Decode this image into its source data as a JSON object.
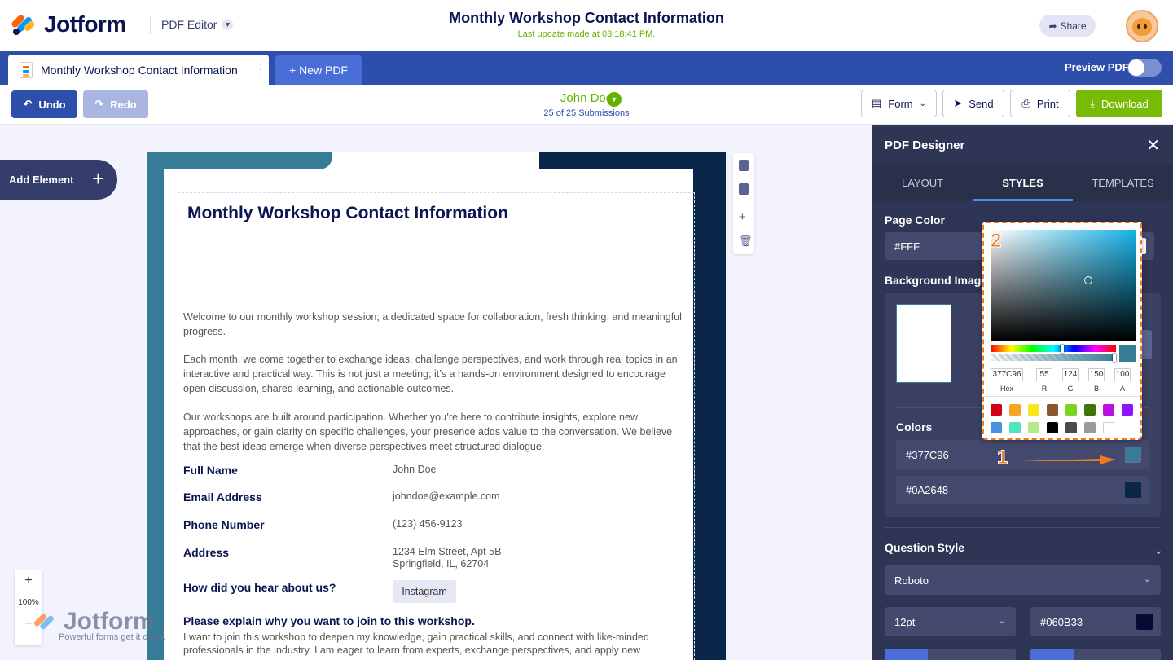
{
  "header": {
    "brand": "Jotform",
    "product": "PDF Editor",
    "doc_title": "Monthly Workshop Contact Information",
    "last_update": "Last update made at 03:18:41 PM.",
    "share_label": "Share"
  },
  "tabs": {
    "active_label": "Monthly Workshop Contact Information",
    "new_label": "+ New PDF",
    "preview_label": "Preview PDF",
    "preview_on": false
  },
  "actions": {
    "undo": "Undo",
    "redo": "Redo",
    "submitter": "John Doe",
    "submission_count": "25 of 25 Submissions",
    "form": "Form",
    "send": "Send",
    "print": "Print",
    "download": "Download"
  },
  "left": {
    "add_element": "Add Element",
    "zoom_in": "+",
    "zoom_level": "100%",
    "zoom_out": "−"
  },
  "watermark": {
    "brand": "Jotform",
    "tagline": "Powerful forms get it done."
  },
  "document": {
    "title": "Monthly Workshop Contact Information",
    "paragraphs": [
      "Welcome to our monthly workshop session; a dedicated space for collaboration, fresh thinking, and meaningful progress.",
      "Each month, we come together to exchange ideas, challenge perspectives, and work through real topics in an interactive and practical way. This is not just a meeting; it’s a hands-on environment designed to encourage open discussion, shared learning, and actionable outcomes.",
      "Our workshops are built around participation. Whether you’re here to contribute insights, explore new approaches, or gain clarity on specific challenges, your presence adds value to the conversation. We believe that the best ideas emerge when diverse perspectives meet structured dialogue."
    ],
    "fields": [
      {
        "label": "Full Name",
        "value": "John Doe"
      },
      {
        "label": "Email Address",
        "value": "johndoe@example.com"
      },
      {
        "label": "Phone Number",
        "value": "(123) 456-9123"
      },
      {
        "label": "Address",
        "value": "1234 Elm Street, Apt 5B",
        "value2": "Springfield, IL, 62704"
      },
      {
        "label": "How did you hear about us?",
        "value": "Instagram"
      }
    ],
    "essay_label": "Please explain why you want to join to this workshop.",
    "essay_text": "I want to join this workshop to deepen my knowledge, gain practical skills, and connect with like-minded professionals in the industry. I am eager to learn from experts, exchange perspectives, and apply new"
  },
  "panel": {
    "title": "PDF Designer",
    "tabs": [
      "LAYOUT",
      "STYLES",
      "TEMPLATES"
    ],
    "active_tab": "STYLES",
    "page_color_label": "Page Color",
    "page_color_value": "#FFF",
    "background_image_label": "Background Image",
    "colors_label": "Colors",
    "color1": "#377C96",
    "color2": "#0A2648",
    "question_style_label": "Question Style",
    "font": "Roboto",
    "font_size": "12pt",
    "font_color": "#060B33"
  },
  "picker": {
    "hex": "377C96",
    "r": "55",
    "g": "124",
    "b": "150",
    "a": "100",
    "labels": [
      "Hex",
      "R",
      "G",
      "B",
      "A"
    ],
    "presets": [
      "#d0021b",
      "#f5a623",
      "#f8e71c",
      "#8b572a",
      "#7ed321",
      "#417505",
      "#bd10e0",
      "#9013fe",
      "#4a90e2",
      "#50e3c2",
      "#b8e986",
      "#000000",
      "#4a4a4a",
      "#9b9b9b",
      "#ffffff"
    ]
  },
  "annotations": {
    "step1": "1",
    "step2": "2"
  },
  "colors": {
    "accent_blue": "#2d4eaa",
    "green": "#78bb07",
    "panel_bg": "#2f3555",
    "frame_teal": "#377c96",
    "frame_navy": "#0a2648",
    "annotation_orange": "#f07b1c"
  }
}
